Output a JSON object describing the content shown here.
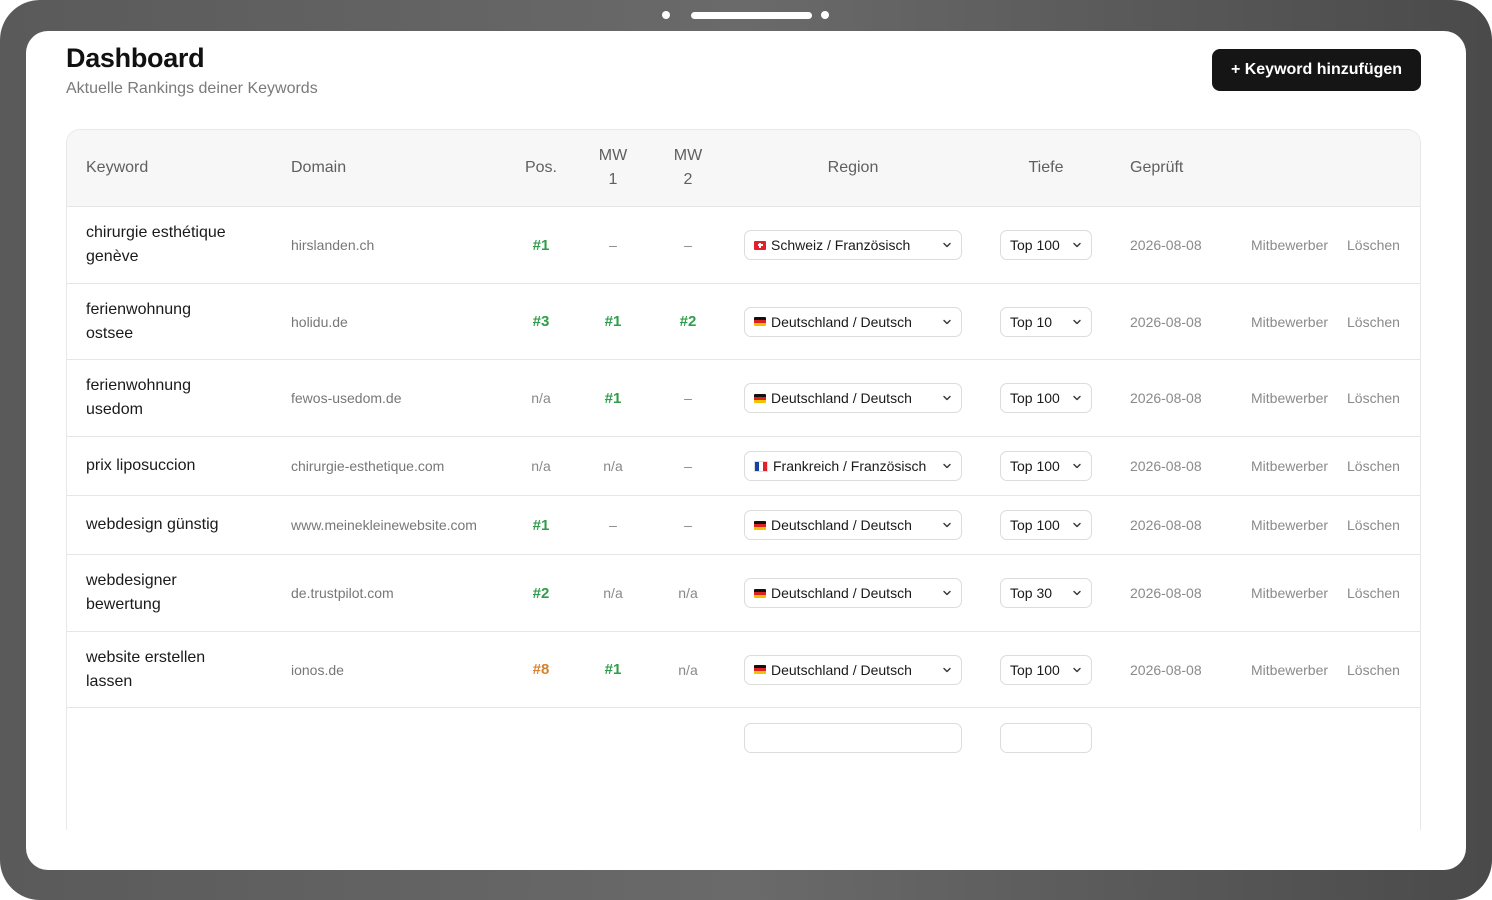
{
  "header": {
    "title": "Dashboard",
    "subtitle": "Aktuelle Rankings deiner Keywords",
    "add_button_label": "+ Keyword hinzufügen"
  },
  "table": {
    "columns": {
      "keyword": "Keyword",
      "domain": "Domain",
      "pos": "Pos.",
      "mw1_line1": "MW",
      "mw1_line2": "1",
      "mw2_line1": "MW",
      "mw2_line2": "2",
      "region": "Region",
      "tiefe": "Tiefe",
      "geprueft": "Geprüft"
    },
    "rows": [
      {
        "keyword_line1": "chirurgie esthétique",
        "keyword_line2": "genève",
        "domain": "hirslanden.ch",
        "pos": "#1",
        "pos_color": "green",
        "mw1": "–",
        "mw1_color": "muted",
        "mw2": "–",
        "mw2_color": "muted",
        "flag": "ch",
        "region": "Schweiz / Französisch",
        "tiefe": "Top 100",
        "date": "2026-08-08",
        "competitors": "Mitbewerber",
        "delete": "Löschen"
      },
      {
        "keyword_line1": "ferienwohnung",
        "keyword_line2": "ostsee",
        "domain": "holidu.de",
        "pos": "#3",
        "pos_color": "green",
        "mw1": "#1",
        "mw1_color": "green",
        "mw2": "#2",
        "mw2_color": "green",
        "flag": "de",
        "region": "Deutschland / Deutsch",
        "tiefe": "Top 10",
        "date": "2026-08-08",
        "competitors": "Mitbewerber",
        "delete": "Löschen"
      },
      {
        "keyword_line1": "ferienwohnung",
        "keyword_line2": "usedom",
        "domain": "fewos-usedom.de",
        "pos": "n/a",
        "pos_color": "muted",
        "mw1": "#1",
        "mw1_color": "green",
        "mw2": "–",
        "mw2_color": "muted",
        "flag": "de",
        "region": "Deutschland / Deutsch",
        "tiefe": "Top 100",
        "date": "2026-08-08",
        "competitors": "Mitbewerber",
        "delete": "Löschen"
      },
      {
        "keyword_line1": "prix liposuccion",
        "keyword_line2": "",
        "domain": "chirurgie-esthetique.com",
        "pos": "n/a",
        "pos_color": "muted",
        "mw1": "n/a",
        "mw1_color": "muted",
        "mw2": "–",
        "mw2_color": "muted",
        "flag": "fr",
        "region": "Frankreich / Französisch",
        "tiefe": "Top 100",
        "date": "2026-08-08",
        "competitors": "Mitbewerber",
        "delete": "Löschen"
      },
      {
        "keyword_line1": "webdesign günstig",
        "keyword_line2": "",
        "domain": "www.meinekleinewebsite.com",
        "pos": "#1",
        "pos_color": "green",
        "mw1": "–",
        "mw1_color": "muted",
        "mw2": "–",
        "mw2_color": "muted",
        "flag": "de",
        "region": "Deutschland / Deutsch",
        "tiefe": "Top 100",
        "date": "2026-08-08",
        "competitors": "Mitbewerber",
        "delete": "Löschen"
      },
      {
        "keyword_line1": "webdesigner",
        "keyword_line2": "bewertung",
        "domain": "de.trustpilot.com",
        "pos": "#2",
        "pos_color": "green",
        "mw1": "n/a",
        "mw1_color": "muted",
        "mw2": "n/a",
        "mw2_color": "muted",
        "flag": "de",
        "region": "Deutschland / Deutsch",
        "tiefe": "Top 30",
        "date": "2026-08-08",
        "competitors": "Mitbewerber",
        "delete": "Löschen"
      },
      {
        "keyword_line1": "website erstellen",
        "keyword_line2": "lassen",
        "domain": "ionos.de",
        "pos": "#8",
        "pos_color": "orange",
        "mw1": "#1",
        "mw1_color": "green",
        "mw2": "n/a",
        "mw2_color": "muted",
        "flag": "de",
        "region": "Deutschland / Deutsch",
        "tiefe": "Top 100",
        "date": "2026-08-08",
        "competitors": "Mitbewerber",
        "delete": "Löschen"
      }
    ]
  },
  "colors": {
    "accent_dark": "#151515",
    "rank_good": "#2e9e4a",
    "rank_mid": "#d9822b",
    "muted": "#888888"
  }
}
